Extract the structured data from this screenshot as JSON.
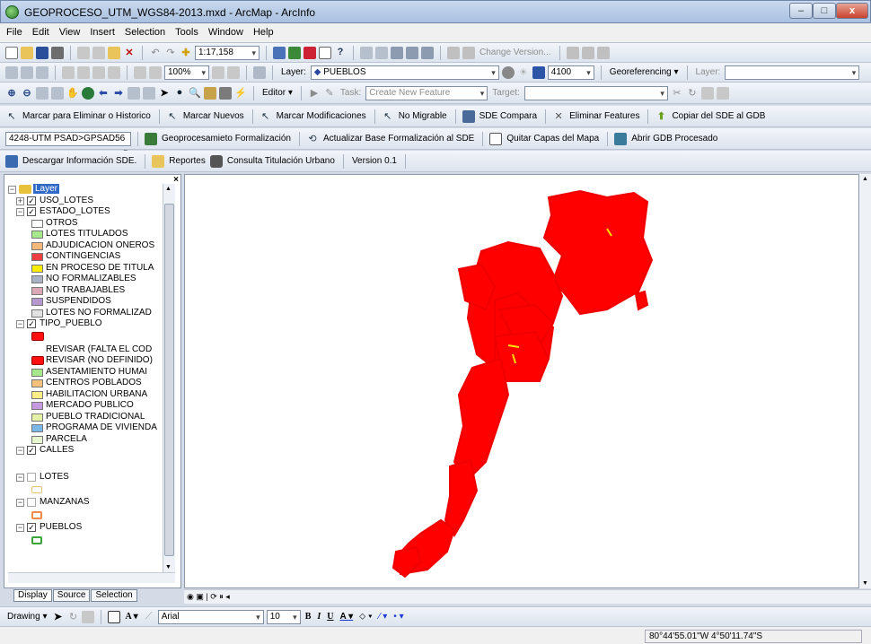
{
  "window": {
    "title": "GEOPROCESO_UTM_WGS84-2013.mxd - ArcMap - ArcInfo"
  },
  "menu": [
    "File",
    "Edit",
    "View",
    "Insert",
    "Selection",
    "Tools",
    "Window",
    "Help"
  ],
  "standard": {
    "scale": "1:17,158"
  },
  "tools": {
    "zoom": "100%",
    "layer_label": "Layer:",
    "layer_value": "PUEBLOS",
    "angle": "4100",
    "georef": "Georeferencing ▾",
    "layer2_label": "Layer:",
    "change_version": "Change Version..."
  },
  "editor": {
    "label": "Editor ▾",
    "task_label": "Task:",
    "task_value": "Create New Feature",
    "target_label": "Target:"
  },
  "custom1": [
    "Marcar para Eliminar o Historico",
    "Marcar Nuevos",
    "Marcar Modificaciones",
    "No Migrable",
    "SDE Compara",
    "Eliminar Features",
    "Copiar del SDE al GDB"
  ],
  "custom2": {
    "dropdown": "4248-UTM PSAD>GPSAD56",
    "items": [
      "Geoprocesamieto Formalización",
      "Actualizar Base Formalización al SDE",
      "Quitar Capas del Mapa",
      "Abrir GDB Procesado"
    ]
  },
  "custom3": {
    "items": [
      "Descargar Información SDE.",
      "Reportes",
      "Consulta Titulación Urbano"
    ],
    "version": "Version 0.1"
  },
  "toc": {
    "root": "Layer",
    "uso_lotes": "USO_LOTES",
    "estado_lotes": {
      "name": "ESTADO_LOTES",
      "classes": [
        {
          "label": "OTROS",
          "color": "#ffffff"
        },
        {
          "label": "LOTES TITULADOS",
          "color": "#a7e88a"
        },
        {
          "label": "ADJUDICACION ONEROS",
          "color": "#f5b87a"
        },
        {
          "label": "CONTINGENCIAS",
          "color": "#ee4040"
        },
        {
          "label": "EN PROCESO DE TITULA",
          "color": "#ffee00"
        },
        {
          "label": "NO FORMALIZABLES",
          "color": "#a8b2c4"
        },
        {
          "label": "NO TRABAJABLES",
          "color": "#dca8b8"
        },
        {
          "label": "SUSPENDIDOS",
          "color": "#b697cf"
        },
        {
          "label": "LOTES NO FORMALIZAD",
          "color": "#e2e2e2"
        }
      ]
    },
    "tipo_pueblo": {
      "name": "TIPO_PUEBLO",
      "revisar1": "REVISAR (FALTA EL COD",
      "revisar2": "REVISAR (NO DEFINIDO)",
      "classes": [
        {
          "label": "ASENTAMIENTO HUMAI",
          "color": "#a7e88a"
        },
        {
          "label": "CENTROS POBLADOS",
          "color": "#f5c07a"
        },
        {
          "label": "HABILITACION URBANA",
          "color": "#ffee88"
        },
        {
          "label": "MERCADO PUBLICO",
          "color": "#c79adf"
        },
        {
          "label": "PUEBLO TRADICIONAL",
          "color": "#e4f2a8"
        },
        {
          "label": "PROGRAMA DE VIVIENDA",
          "color": "#7ab7e8"
        },
        {
          "label": "PARCELA",
          "color": "#e6f7d0"
        }
      ]
    },
    "calles": "CALLES",
    "lotes": "LOTES",
    "manzanas": "MANZANAS",
    "pueblos": "PUEBLOS"
  },
  "tabs": [
    "Display",
    "Source",
    "Selection"
  ],
  "drawing": {
    "label": "Drawing ▾",
    "font": "Arial",
    "size": "10"
  },
  "status": {
    "coords": "80°44'55.01\"W  4°50'11.74\"S"
  },
  "colors": {
    "features": "#ff0000",
    "highlight": "#ffe000"
  }
}
